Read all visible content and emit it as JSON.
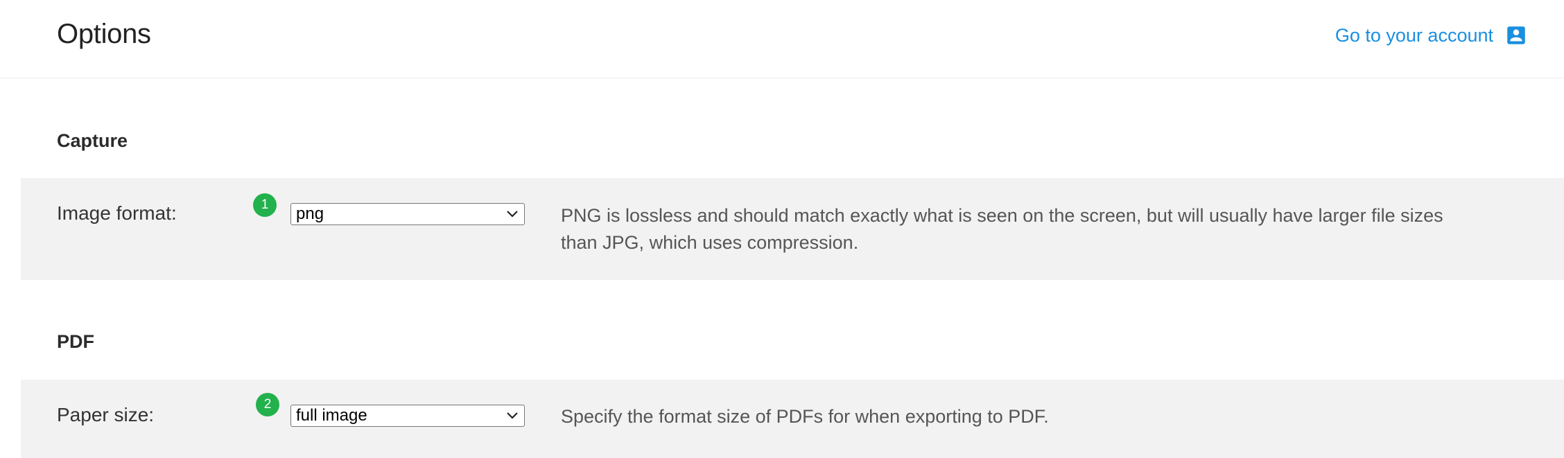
{
  "header": {
    "title": "Options",
    "account_link": "Go to your account",
    "account_icon": "account-box-icon"
  },
  "sections": [
    {
      "heading": "Capture",
      "option": {
        "badge": "1",
        "label": "Image format:",
        "select_value": "png",
        "description": "PNG is lossless and should match exactly what is seen on the screen, but will usually have larger file sizes than JPG, which uses compression."
      }
    },
    {
      "heading": "PDF",
      "option": {
        "badge": "2",
        "label": "Paper size:",
        "select_value": "full image",
        "description": "Specify the format size of PDFs for when exporting to PDF."
      }
    }
  ],
  "colors": {
    "accent_link": "#1a8fdf",
    "badge_green": "#22b14c",
    "row_background": "#f2f2f2"
  }
}
